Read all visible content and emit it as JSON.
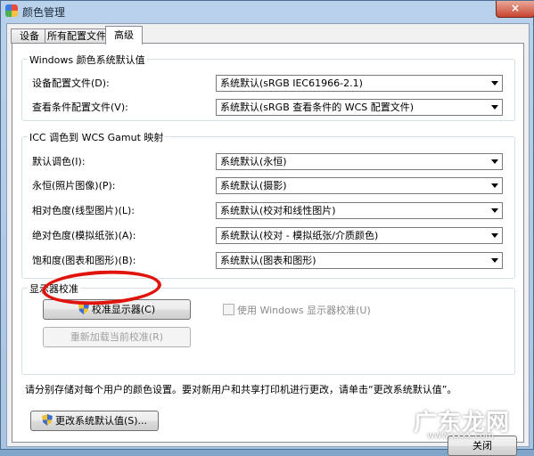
{
  "window": {
    "title": "颜色管理",
    "close_glyph": "×"
  },
  "tabs": [
    {
      "label": "设备"
    },
    {
      "label": "所有配置文件"
    },
    {
      "label": "高级"
    }
  ],
  "windows_defaults": {
    "title": "Windows 颜色系统默认值",
    "rows": [
      {
        "label": "设备配置文件(D):",
        "value": "系统默认(sRGB IEC61966-2.1)"
      },
      {
        "label": "查看条件配置文件(V):",
        "value": "系统默认(sRGB 查看条件的 WCS 配置文件)"
      }
    ]
  },
  "icc_mapping": {
    "title": "ICC 调色到 WCS Gamut 映射",
    "rows": [
      {
        "label": "默认调色(I):",
        "value": "系统默认(永恒)"
      },
      {
        "label": "永恒(照片图像)(P):",
        "value": "系统默认(摄影)"
      },
      {
        "label": "相对色度(线型图片)(L):",
        "value": "系统默认(校对和线性图片)"
      },
      {
        "label": "绝对色度(模拟纸张)(A):",
        "value": "系统默认(校对 - 模拟纸张/介质颜色)"
      },
      {
        "label": "饱和度(图表和图形)(B):",
        "value": "系统默认(图表和图形)"
      }
    ]
  },
  "calibration": {
    "title": "显示器校准",
    "calibrate_button": "校准显示器(C)",
    "use_windows_calibration": "使用 Windows 显示器校准(U)",
    "reload_button": "重新加载当前校准(R)"
  },
  "info_text": "请分别存储对每个用户的颜色设置。要对新用户和共享打印机进行更改，请单击“更改系统默认值”。",
  "change_defaults_button": "更改系统默认值(S)...",
  "close_button_partial": "关闭",
  "watermark": {
    "main": "广东龙网",
    "sub": "www.xxxx.com"
  },
  "colors": {
    "annotation": "#e0140c",
    "title_bar": "#b9d1ea"
  }
}
